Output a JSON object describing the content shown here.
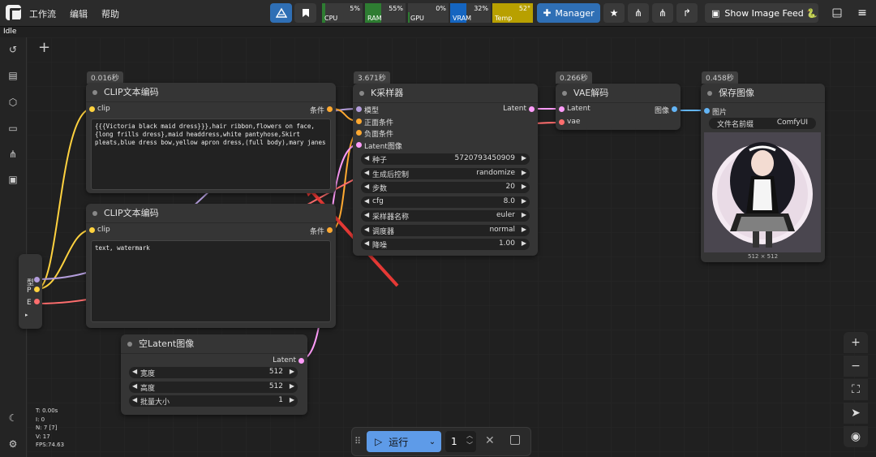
{
  "menu": {
    "workflow": "工作流",
    "edit": "编辑",
    "help": "帮助"
  },
  "monitors": [
    {
      "label": "CPU",
      "value": "5%",
      "level": 0.05,
      "color": "#2e7d32"
    },
    {
      "label": "RAM",
      "value": "55%",
      "level": 0.55,
      "color": "#2e7d32"
    },
    {
      "label": "GPU",
      "value": "0%",
      "level": 0.0,
      "color": "#2e7d32"
    },
    {
      "label": "VRAM",
      "value": "32%",
      "level": 0.32,
      "color": "#1565c0"
    },
    {
      "label": "Temp",
      "value": "52°",
      "level": 0.52,
      "color": "#b8a000"
    }
  ],
  "toolbar": {
    "manager": "Manager",
    "image_feed": "Show Image Feed 🐍"
  },
  "status": "Idle",
  "stats": {
    "t": "T: 0.00s",
    "i": "I: 0",
    "n": "N: 7 [7]",
    "v": "V: 17",
    "fps": "FPS:74.63"
  },
  "nodes": {
    "clip1": {
      "badge": "0.016秒",
      "title": "CLIP文本编码",
      "input": "clip",
      "output": "条件",
      "text": "{{{Victoria black maid dress}}},hair ribbon,flowers on face,{long frills dress},maid headdress,white pantyhose,Skirt pleats,blue dress bow,yellow apron dress,(full body),mary janes"
    },
    "clip2": {
      "title": "CLIP文本编码",
      "input": "clip",
      "output": "条件",
      "text": "text, watermark"
    },
    "ksampler": {
      "badge": "3.671秒",
      "title": "K采样器",
      "inputs": [
        "模型",
        "正面条件",
        "负面条件",
        "Latent图像"
      ],
      "output": "Latent",
      "widgets": [
        {
          "label": "种子",
          "value": "5720793450909"
        },
        {
          "label": "生成后控制",
          "value": "randomize"
        },
        {
          "label": "步数",
          "value": "20"
        },
        {
          "label": "cfg",
          "value": "8.0"
        },
        {
          "label": "采样器名称",
          "value": "euler"
        },
        {
          "label": "调度器",
          "value": "normal"
        },
        {
          "label": "降噪",
          "value": "1.00"
        }
      ]
    },
    "vae": {
      "badge": "0.266秒",
      "title": "VAE解码",
      "inputs": [
        "Latent",
        "vae"
      ],
      "output": "图像"
    },
    "save": {
      "badge": "0.458秒",
      "title": "保存图像",
      "input": "图片",
      "prefix_label": "文件名前缀",
      "prefix_value": "ComfyUI",
      "size": "512 × 512"
    },
    "latent": {
      "title": "空Latent图像",
      "output": "Latent",
      "widgets": [
        {
          "label": "宽度",
          "value": "512"
        },
        {
          "label": "高度",
          "value": "512"
        },
        {
          "label": "批量大小",
          "value": "1"
        }
      ]
    },
    "checkpoint": {
      "slots": [
        "型",
        "P",
        "E"
      ]
    }
  },
  "run": {
    "label": "运行",
    "count": "1"
  },
  "colors": {
    "clip": "#ffd23f",
    "cond": "#ffa931",
    "latent": "#ff9cf9",
    "model": "#b39ddb",
    "vae": "#ff6e6e",
    "image": "#64b5f6",
    "accent": "#2f6fb5"
  }
}
